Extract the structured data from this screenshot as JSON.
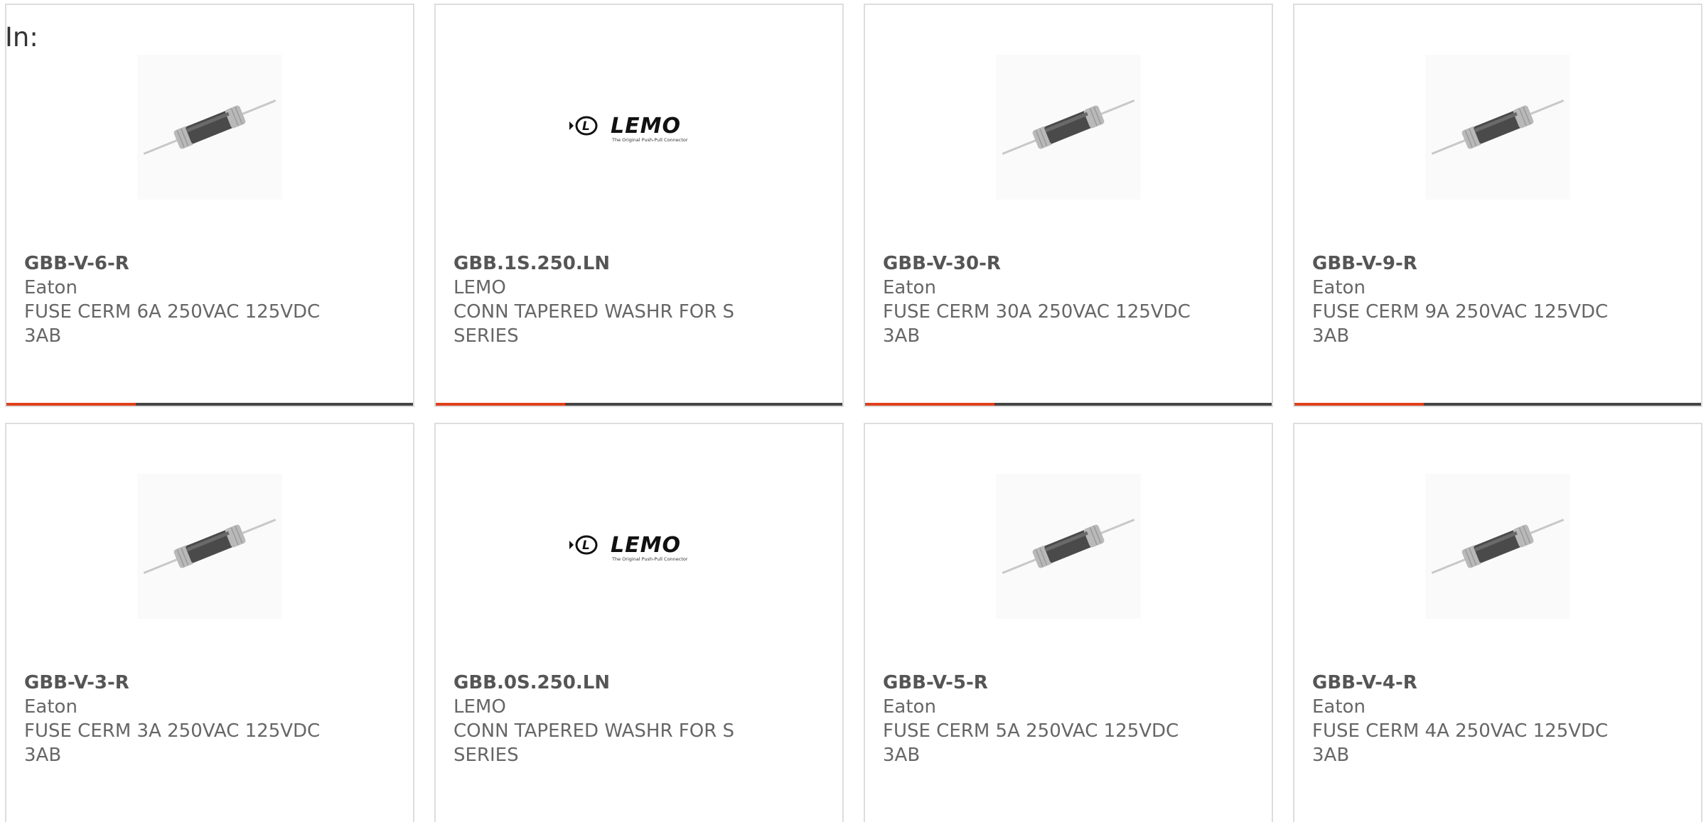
{
  "label": "In:",
  "products": [
    {
      "part_number": "GBB-V-6-R",
      "manufacturer": "Eaton",
      "description": "FUSE CERM 6A 250VAC 125VDC 3AB",
      "image": "fuse-image"
    },
    {
      "part_number": "GBB.1S.250.LN",
      "manufacturer": "LEMO",
      "description": "CONN TAPERED WASHR FOR S SERIES",
      "image": "lemo-logo",
      "logo_text": "LEMO",
      "logo_tagline": "The Original Push-Pull Connector"
    },
    {
      "part_number": "GBB-V-30-R",
      "manufacturer": "Eaton",
      "description": "FUSE CERM 30A 250VAC 125VDC 3AB",
      "image": "fuse-image"
    },
    {
      "part_number": "GBB-V-9-R",
      "manufacturer": "Eaton",
      "description": "FUSE CERM 9A 250VAC 125VDC 3AB",
      "image": "fuse-image"
    },
    {
      "part_number": "GBB-V-3-R",
      "manufacturer": "Eaton",
      "description": "FUSE CERM 3A 250VAC 125VDC 3AB",
      "image": "fuse-image"
    },
    {
      "part_number": "GBB.0S.250.LN",
      "manufacturer": "LEMO",
      "description": "CONN TAPERED WASHR FOR S SERIES",
      "image": "lemo-logo",
      "logo_text": "LEMO",
      "logo_tagline": "The Original Push-Pull Connector"
    },
    {
      "part_number": "GBB-V-5-R",
      "manufacturer": "Eaton",
      "description": "FUSE CERM 5A 250VAC 125VDC 3AB",
      "image": "fuse-image"
    },
    {
      "part_number": "GBB-V-4-R",
      "manufacturer": "Eaton",
      "description": "FUSE CERM 4A 250VAC 125VDC 3AB",
      "image": "fuse-image"
    }
  ],
  "colors": {
    "accent": "#e0401a",
    "bar": "#444444",
    "border": "#dddddd",
    "text": "#666666"
  }
}
